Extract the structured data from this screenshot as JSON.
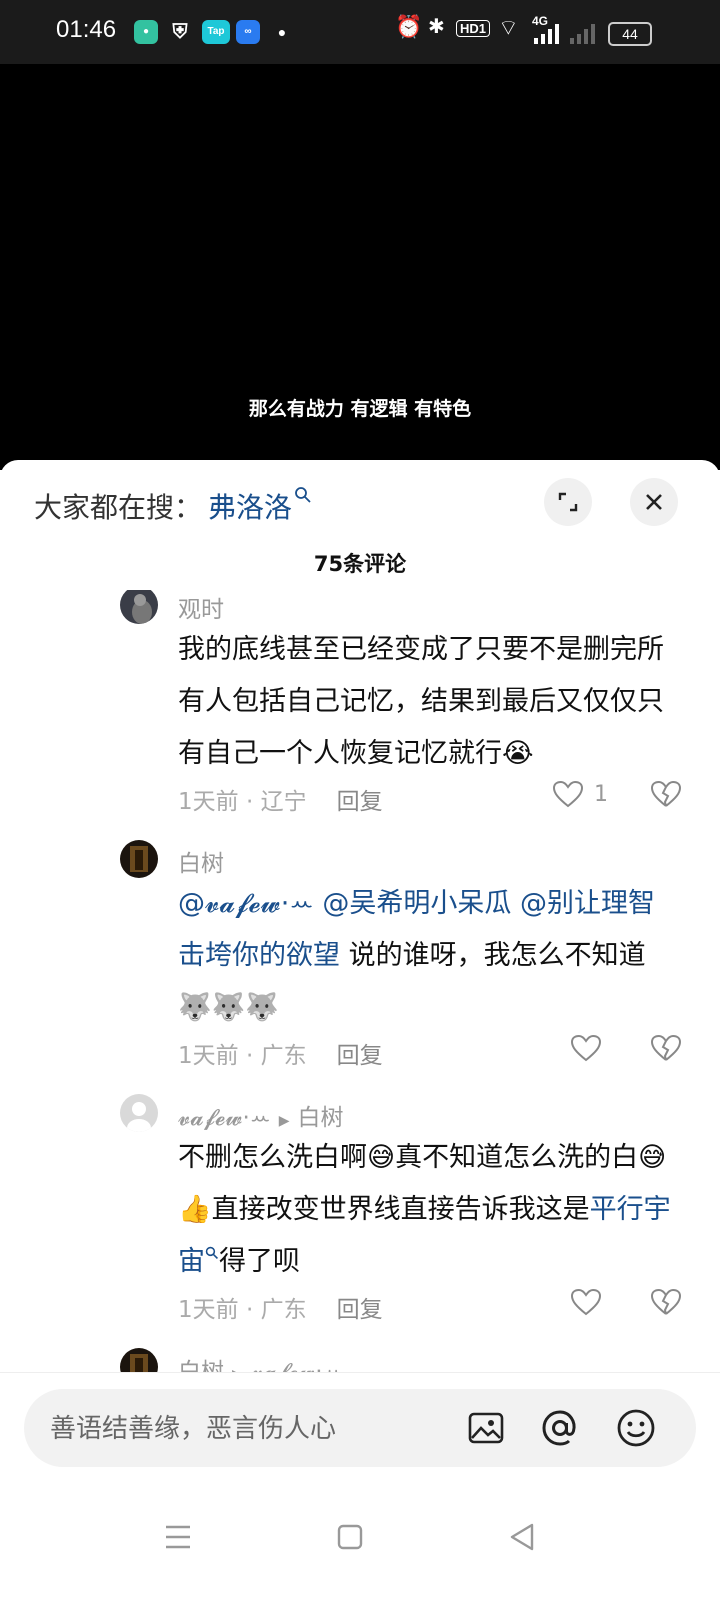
{
  "status_bar": {
    "time": "01:46",
    "network": "4G",
    "hd": "HD1",
    "battery": "44",
    "tap_label": "Tap"
  },
  "video": {
    "subtitle": "那么有战力 有逻辑 有特色"
  },
  "search": {
    "label": "大家都在搜：",
    "keyword": "弗洛洛"
  },
  "comments_title": "75条评论",
  "comments": [
    {
      "author": "观时",
      "text": "我的底线甚至已经变成了只要不是删完所有人包括自己记忆，结果到最后又仅仅只有自己一个人恢复记忆就行",
      "emoji": "😭",
      "meta": "1天前 · 辽宁",
      "reply": "回复",
      "likes": "1"
    },
    {
      "author": "白树",
      "mentions": "@𝓿𝓪𝓯𝓮𝔀·ꕀ @吴希明小呆瓜 @别让理智击垮你的欲望",
      "text": " 说的谁呀，我怎么不知道",
      "emoji": "🐺🐺🐺",
      "meta": "1天前 · 广东",
      "reply": "回复"
    },
    {
      "author": "𝓿𝓪𝓯𝓮𝔀·ꕀ",
      "reply_to": "白树",
      "text1": "不删怎么洗白啊",
      "emoji1": "😅",
      "text2": "真不知道怎么洗的白",
      "emoji2": "😅👍",
      "text3": "直接改变世界线直接告诉我这是",
      "link": "平行宇宙",
      "text4": "得了呗",
      "meta": "1天前 · 广东",
      "reply": "回复"
    },
    {
      "author": "白树",
      "reply_to": "𝓿𝓪𝓯𝓮𝔀·ꕀ"
    }
  ],
  "input": {
    "placeholder": "善语结善缘，恶言伤人心"
  },
  "icons": {
    "expand": "expand-icon",
    "close": "close-icon",
    "like": "heart-icon",
    "dislike": "broken-heart-icon",
    "image": "image-icon",
    "mention": "at-icon",
    "emoji": "emoji-icon",
    "nav_menu": "menu-icon",
    "nav_home": "home-icon",
    "nav_back": "back-icon"
  },
  "colors": {
    "link": "#1a4f8c",
    "meta": "#aaaaaa",
    "status_bar": "#1b1b1b"
  }
}
